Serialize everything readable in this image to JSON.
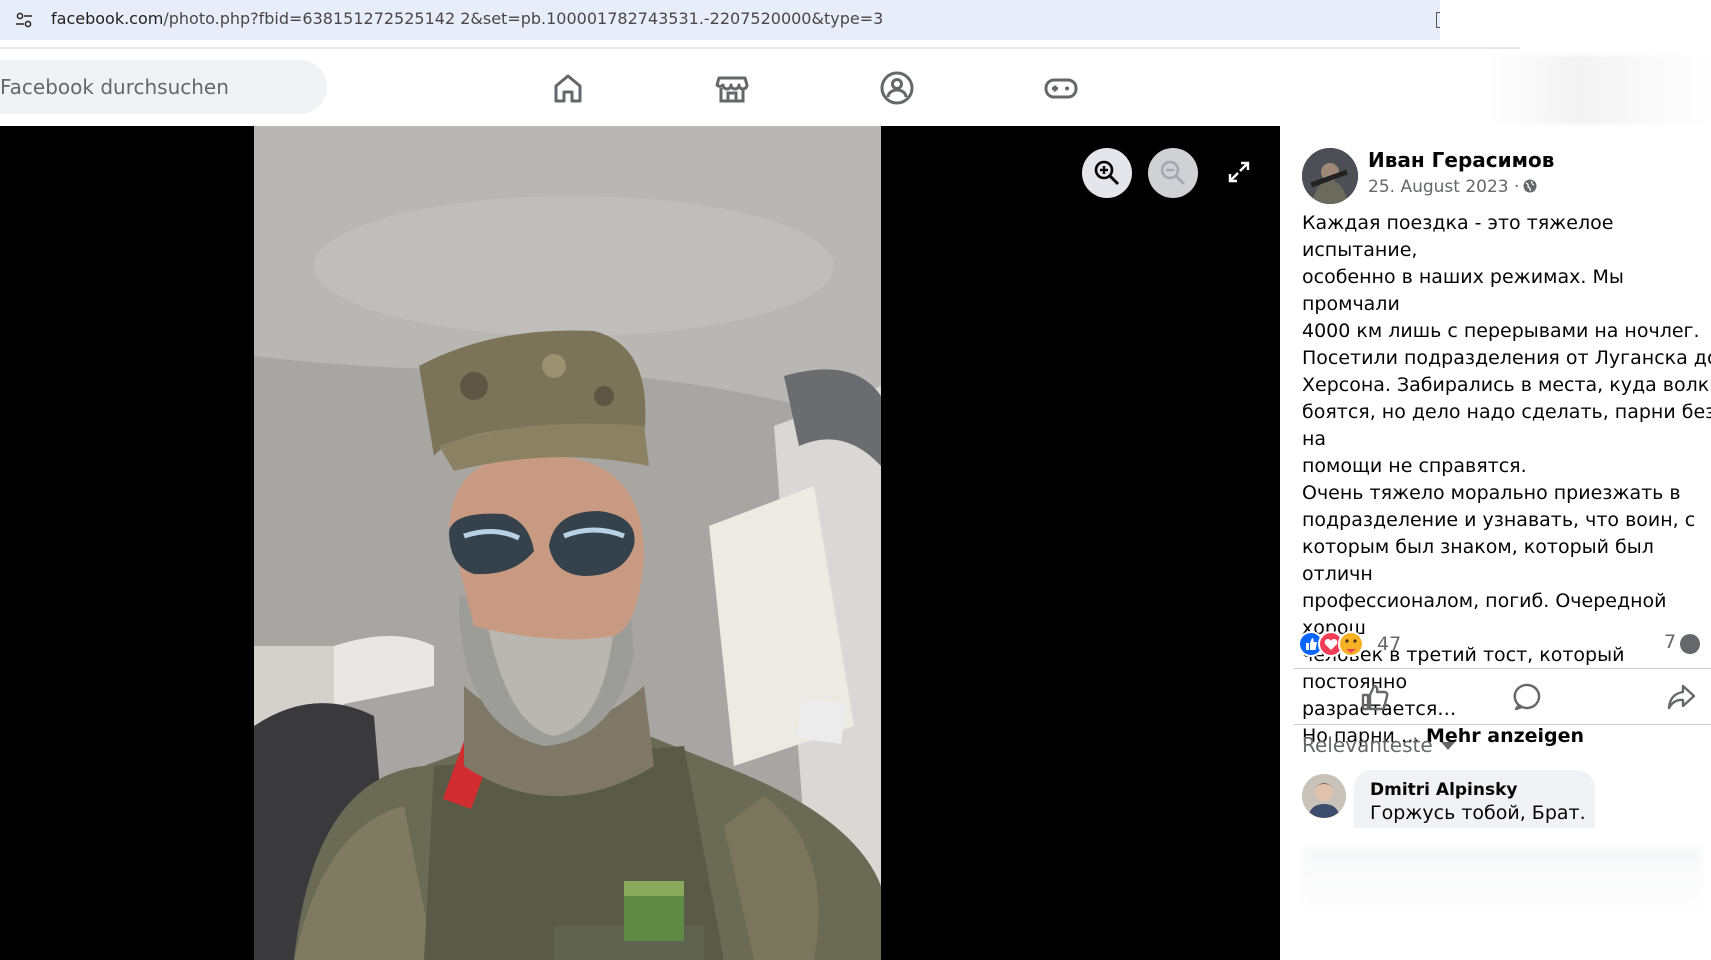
{
  "browser": {
    "url_host": "facebook.com",
    "url_path": "/photo.php?fbid=638151272525142 2&set=pb.100001782743531.-2207520000&type=3"
  },
  "header": {
    "search_placeholder": "Facebook durchsuchen",
    "nav": [
      "home-icon",
      "marketplace-icon",
      "groups-icon",
      "gaming-icon"
    ]
  },
  "viewer": {
    "zoom_in_icon": "zoom-in-icon",
    "zoom_out_icon": "zoom-out-icon",
    "fullscreen_icon": "expand-icon"
  },
  "post": {
    "author": "Иван Герасимов",
    "date": "25. August 2023 ·",
    "audience_icon": "globe-icon",
    "text": "Каждая поездка - это тяжелое испытание,\nособенно в наших режимах. Мы промчали\n4000 км лишь с перерывами на ночлег.\nПосетили подразделения от Луганска до\nХерсона. Забирались в места, куда волки\nбоятся, но дело надо сделать, парни без на\nпомощи не справятся.\nОчень тяжело морально приезжать в\nподразделение и узнавать, что воин, с\nкоторым был знаком, который был отличн\nпрофессионалом, погиб. Очередной хорош\nчеловек в третий тост, который постоянно\nразрастается…\nНо парни … ",
    "see_more": "Mehr anzeigen",
    "reaction_count": "47",
    "comment_count": "7",
    "reactions": [
      "like",
      "love",
      "care"
    ]
  },
  "comments": {
    "sort_label": "Relevanteste",
    "items": [
      {
        "name": "Dmitri Alpinsky",
        "text": "Горжусь тобой, Брат."
      }
    ]
  },
  "colors": {
    "accent": "#0866ff",
    "love": "#f33e58",
    "care": "#f7b125"
  }
}
